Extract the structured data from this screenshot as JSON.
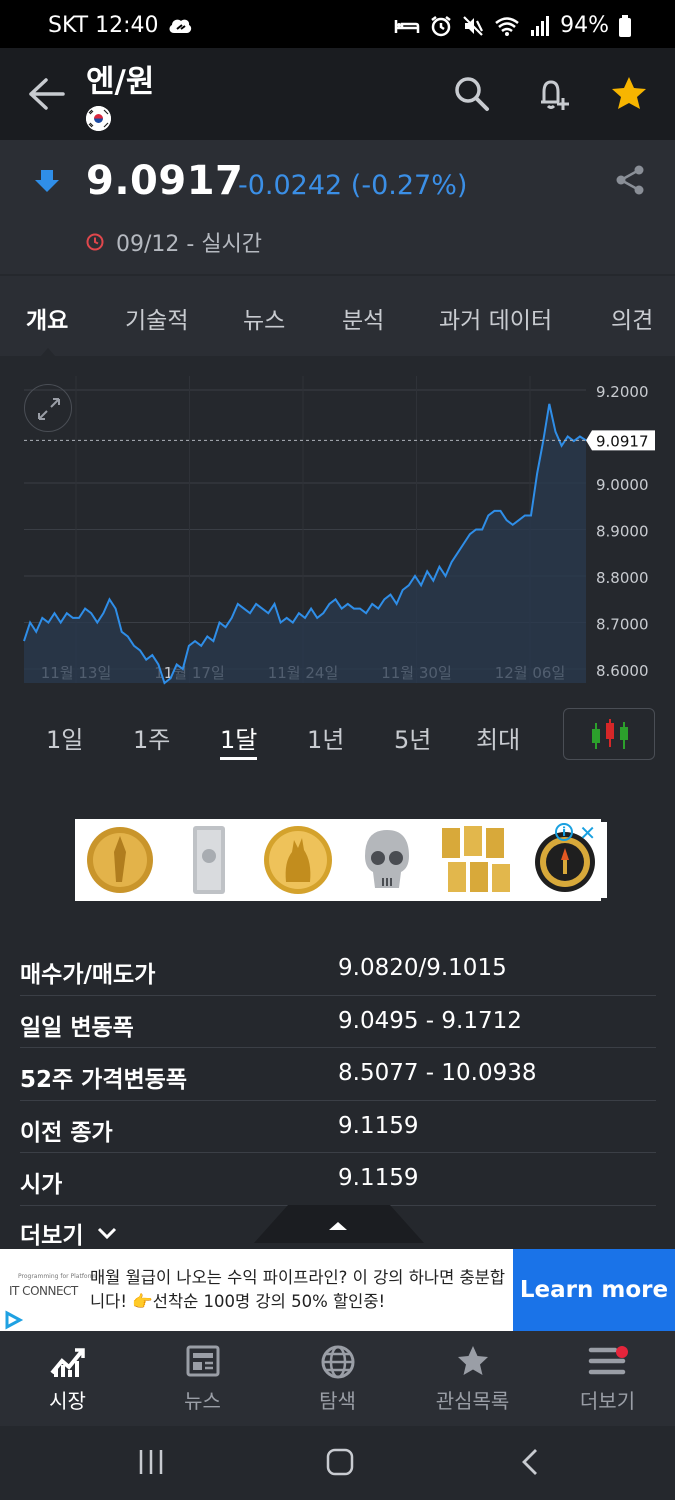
{
  "status_bar": {
    "carrier_time": "SKT 12:40",
    "battery": "94%"
  },
  "header": {
    "title": "엔/원",
    "flag_icon": "korea-flag-icon"
  },
  "quote": {
    "price": "9.0917",
    "change": "-0.0242 (-0.27%)",
    "timestamp": "09/12 - 실시간",
    "colors": {
      "negative": "#3b8fe6"
    }
  },
  "tabs": [
    "개요",
    "기술적",
    "뉴스",
    "분석",
    "과거 데이터",
    "의견"
  ],
  "chart_data": {
    "type": "area",
    "x_tick_labels": [
      "11월 13일",
      "11월 17일",
      "11월 24일",
      "11월 30일",
      "12월 06일"
    ],
    "y_tick_labels": [
      "9.2000",
      "9.0000",
      "8.9000",
      "8.8000",
      "8.7000",
      "8.6000"
    ],
    "ylim": [
      8.57,
      9.23
    ],
    "current_value_label": "9.0917",
    "current_value": 9.0917,
    "values": [
      8.66,
      8.7,
      8.68,
      8.71,
      8.7,
      8.72,
      8.7,
      8.72,
      8.71,
      8.71,
      8.73,
      8.72,
      8.7,
      8.72,
      8.75,
      8.73,
      8.68,
      8.67,
      8.65,
      8.64,
      8.62,
      8.63,
      8.61,
      8.57,
      8.58,
      8.61,
      8.6,
      8.65,
      8.66,
      8.65,
      8.67,
      8.66,
      8.7,
      8.69,
      8.71,
      8.74,
      8.73,
      8.72,
      8.74,
      8.73,
      8.72,
      8.74,
      8.7,
      8.71,
      8.7,
      8.72,
      8.71,
      8.73,
      8.71,
      8.72,
      8.74,
      8.75,
      8.73,
      8.74,
      8.73,
      8.73,
      8.72,
      8.74,
      8.73,
      8.75,
      8.76,
      8.74,
      8.77,
      8.78,
      8.8,
      8.78,
      8.81,
      8.79,
      8.82,
      8.8,
      8.83,
      8.85,
      8.87,
      8.89,
      8.9,
      8.9,
      8.93,
      8.94,
      8.94,
      8.92,
      8.91,
      8.92,
      8.93,
      8.93,
      9.02,
      9.09,
      9.17,
      9.11,
      9.08,
      9.1,
      9.09,
      9.1,
      9.0917
    ],
    "grid": true
  },
  "ranges": [
    "1일",
    "1주",
    "1달",
    "1년",
    "5년",
    "최대"
  ],
  "active_range": "1달",
  "stats": [
    {
      "label": "매수가/매도가",
      "value": "9.0820/9.1015"
    },
    {
      "label": "일일 변동폭",
      "value": "9.0495 - 9.1712"
    },
    {
      "label": "52주 가격변동폭",
      "value": "8.5077 - 10.0938"
    },
    {
      "label": "이전 종가",
      "value": "9.1159"
    },
    {
      "label": "시가",
      "value": "9.1159"
    }
  ],
  "more_label": "더보기",
  "bottom_ad": {
    "brand_small": "Programming for Platform",
    "brand": "IT CONNECT",
    "text": "매월 월급이 나오는 수익 파이프라인? 이 강의 하나면 충분합니다! 👉선착순 100명 강의 50% 할인중!",
    "cta": "Learn more"
  },
  "bottom_nav": [
    "시장",
    "뉴스",
    "탐색",
    "관심목록",
    "더보기"
  ]
}
